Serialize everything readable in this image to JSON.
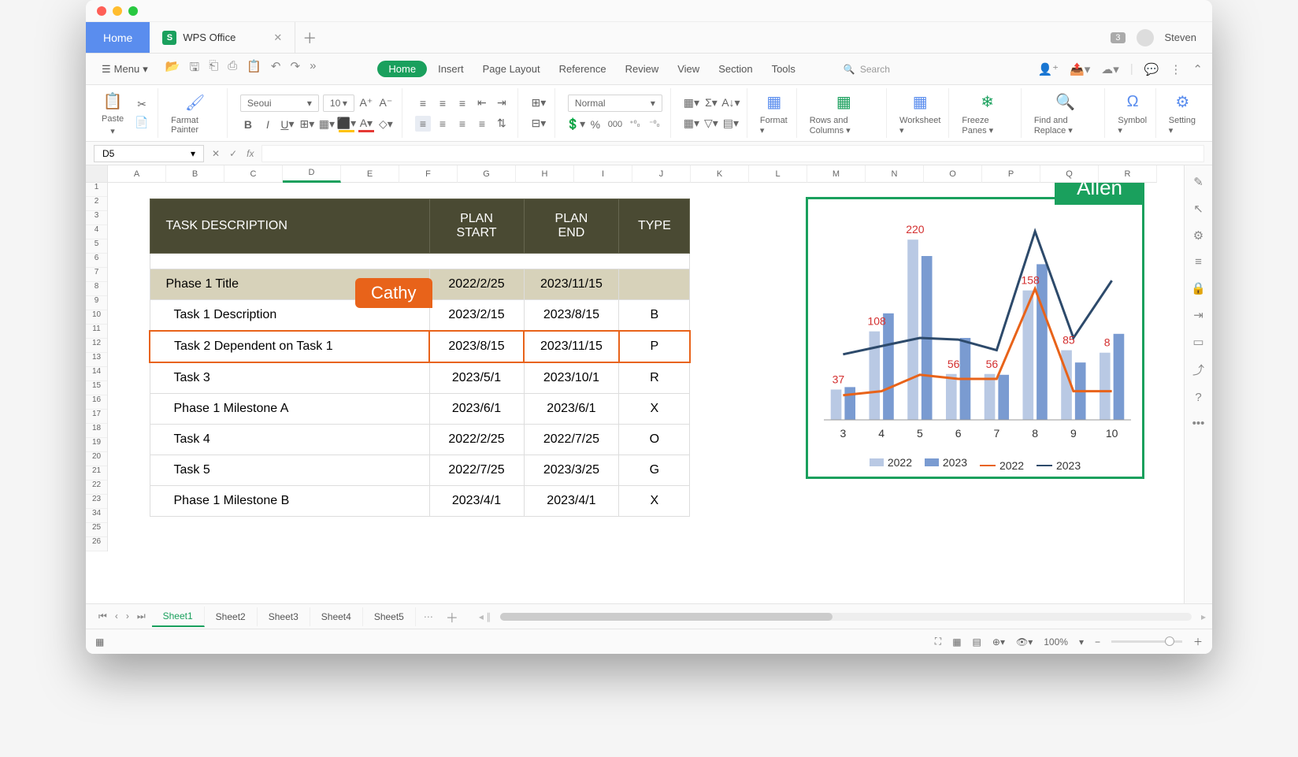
{
  "user": {
    "name": "Steven",
    "notifications": "3"
  },
  "tabs": {
    "home": "Home",
    "doc": "WPS Office"
  },
  "menu": {
    "label": "Menu"
  },
  "ribbon_tabs": [
    "Home",
    "Insert",
    "Page Layout",
    "Reference",
    "Review",
    "View",
    "Section",
    "Tools"
  ],
  "search": {
    "placeholder": "Search"
  },
  "ribbon": {
    "paste": "Paste",
    "format_painter": "Farmat Painter",
    "font": "Seoui",
    "size": "10",
    "cell_style": "Normal",
    "format": "Format",
    "rows_cols": "Rows and Columns",
    "worksheet": "Worksheet",
    "freeze": "Freeze Panes",
    "find_replace": "Find and Replace",
    "symbol": "Symbol",
    "setting": "Setting"
  },
  "namebox": "D5",
  "columns": [
    "A",
    "B",
    "C",
    "D",
    "E",
    "F",
    "G",
    "H",
    "I",
    "J",
    "K",
    "L",
    "M",
    "N",
    "O",
    "P",
    "Q",
    "R"
  ],
  "rows": [
    1,
    2,
    3,
    4,
    5,
    6,
    7,
    8,
    9,
    10,
    11,
    12,
    13,
    14,
    15,
    16,
    17,
    18,
    19,
    20,
    21,
    22,
    23,
    34,
    25,
    26
  ],
  "table": {
    "headers": [
      "TASK DESCRIPTION",
      "PLAN START",
      "PLAN END",
      "TYPE"
    ],
    "phase": {
      "desc": "Phase 1 Title",
      "start": "2022/2/25",
      "end": "2023/11/15",
      "type": ""
    },
    "rows": [
      {
        "desc": "Task 1 Description",
        "start": "2023/2/15",
        "end": "2023/8/15",
        "type": "B"
      },
      {
        "desc": "Task 2 Dependent on Task 1",
        "start": "2023/8/15",
        "end": "2023/11/15",
        "type": "P"
      },
      {
        "desc": "Task 3",
        "start": "2023/5/1",
        "end": "2023/10/1",
        "type": "R"
      },
      {
        "desc": "Phase 1 Milestone A",
        "start": "2023/6/1",
        "end": "2023/6/1",
        "type": "X"
      },
      {
        "desc": "Task 4",
        "start": "2022/2/25",
        "end": "2022/7/25",
        "type": "O"
      },
      {
        "desc": "Task 5",
        "start": "2022/7/25",
        "end": "2023/3/25",
        "type": "G"
      },
      {
        "desc": "Phase 1 Milestone B",
        "start": "2023/4/1",
        "end": "2023/4/1",
        "type": "X"
      }
    ]
  },
  "collaborators": {
    "cathy": "Cathy",
    "allen": "Allen"
  },
  "chart_data": {
    "type": "combo",
    "categories": [
      3,
      4,
      5,
      6,
      7,
      8,
      9,
      10
    ],
    "series": [
      {
        "name": "2022",
        "kind": "bar",
        "color": "#b9c9e4",
        "values": [
          37,
          108,
          220,
          56,
          56,
          158,
          85,
          82
        ]
      },
      {
        "name": "2023",
        "kind": "bar",
        "color": "#7a9bd1",
        "values": [
          40,
          130,
          200,
          100,
          55,
          190,
          70,
          105
        ]
      },
      {
        "name": "2022",
        "kind": "line",
        "color": "#e8631a",
        "values": [
          30,
          35,
          55,
          50,
          50,
          160,
          35,
          35
        ]
      },
      {
        "name": "2023",
        "kind": "line",
        "color": "#2d4a6b",
        "values": [
          80,
          90,
          100,
          98,
          85,
          230,
          100,
          170
        ]
      }
    ],
    "data_labels": [
      37,
      108,
      220,
      56,
      56,
      158,
      85,
      8
    ],
    "ylim": [
      0,
      250
    ]
  },
  "sheets": [
    "Sheet1",
    "Sheet2",
    "Sheet3",
    "Sheet4",
    "Sheet5"
  ],
  "zoom": "100%"
}
